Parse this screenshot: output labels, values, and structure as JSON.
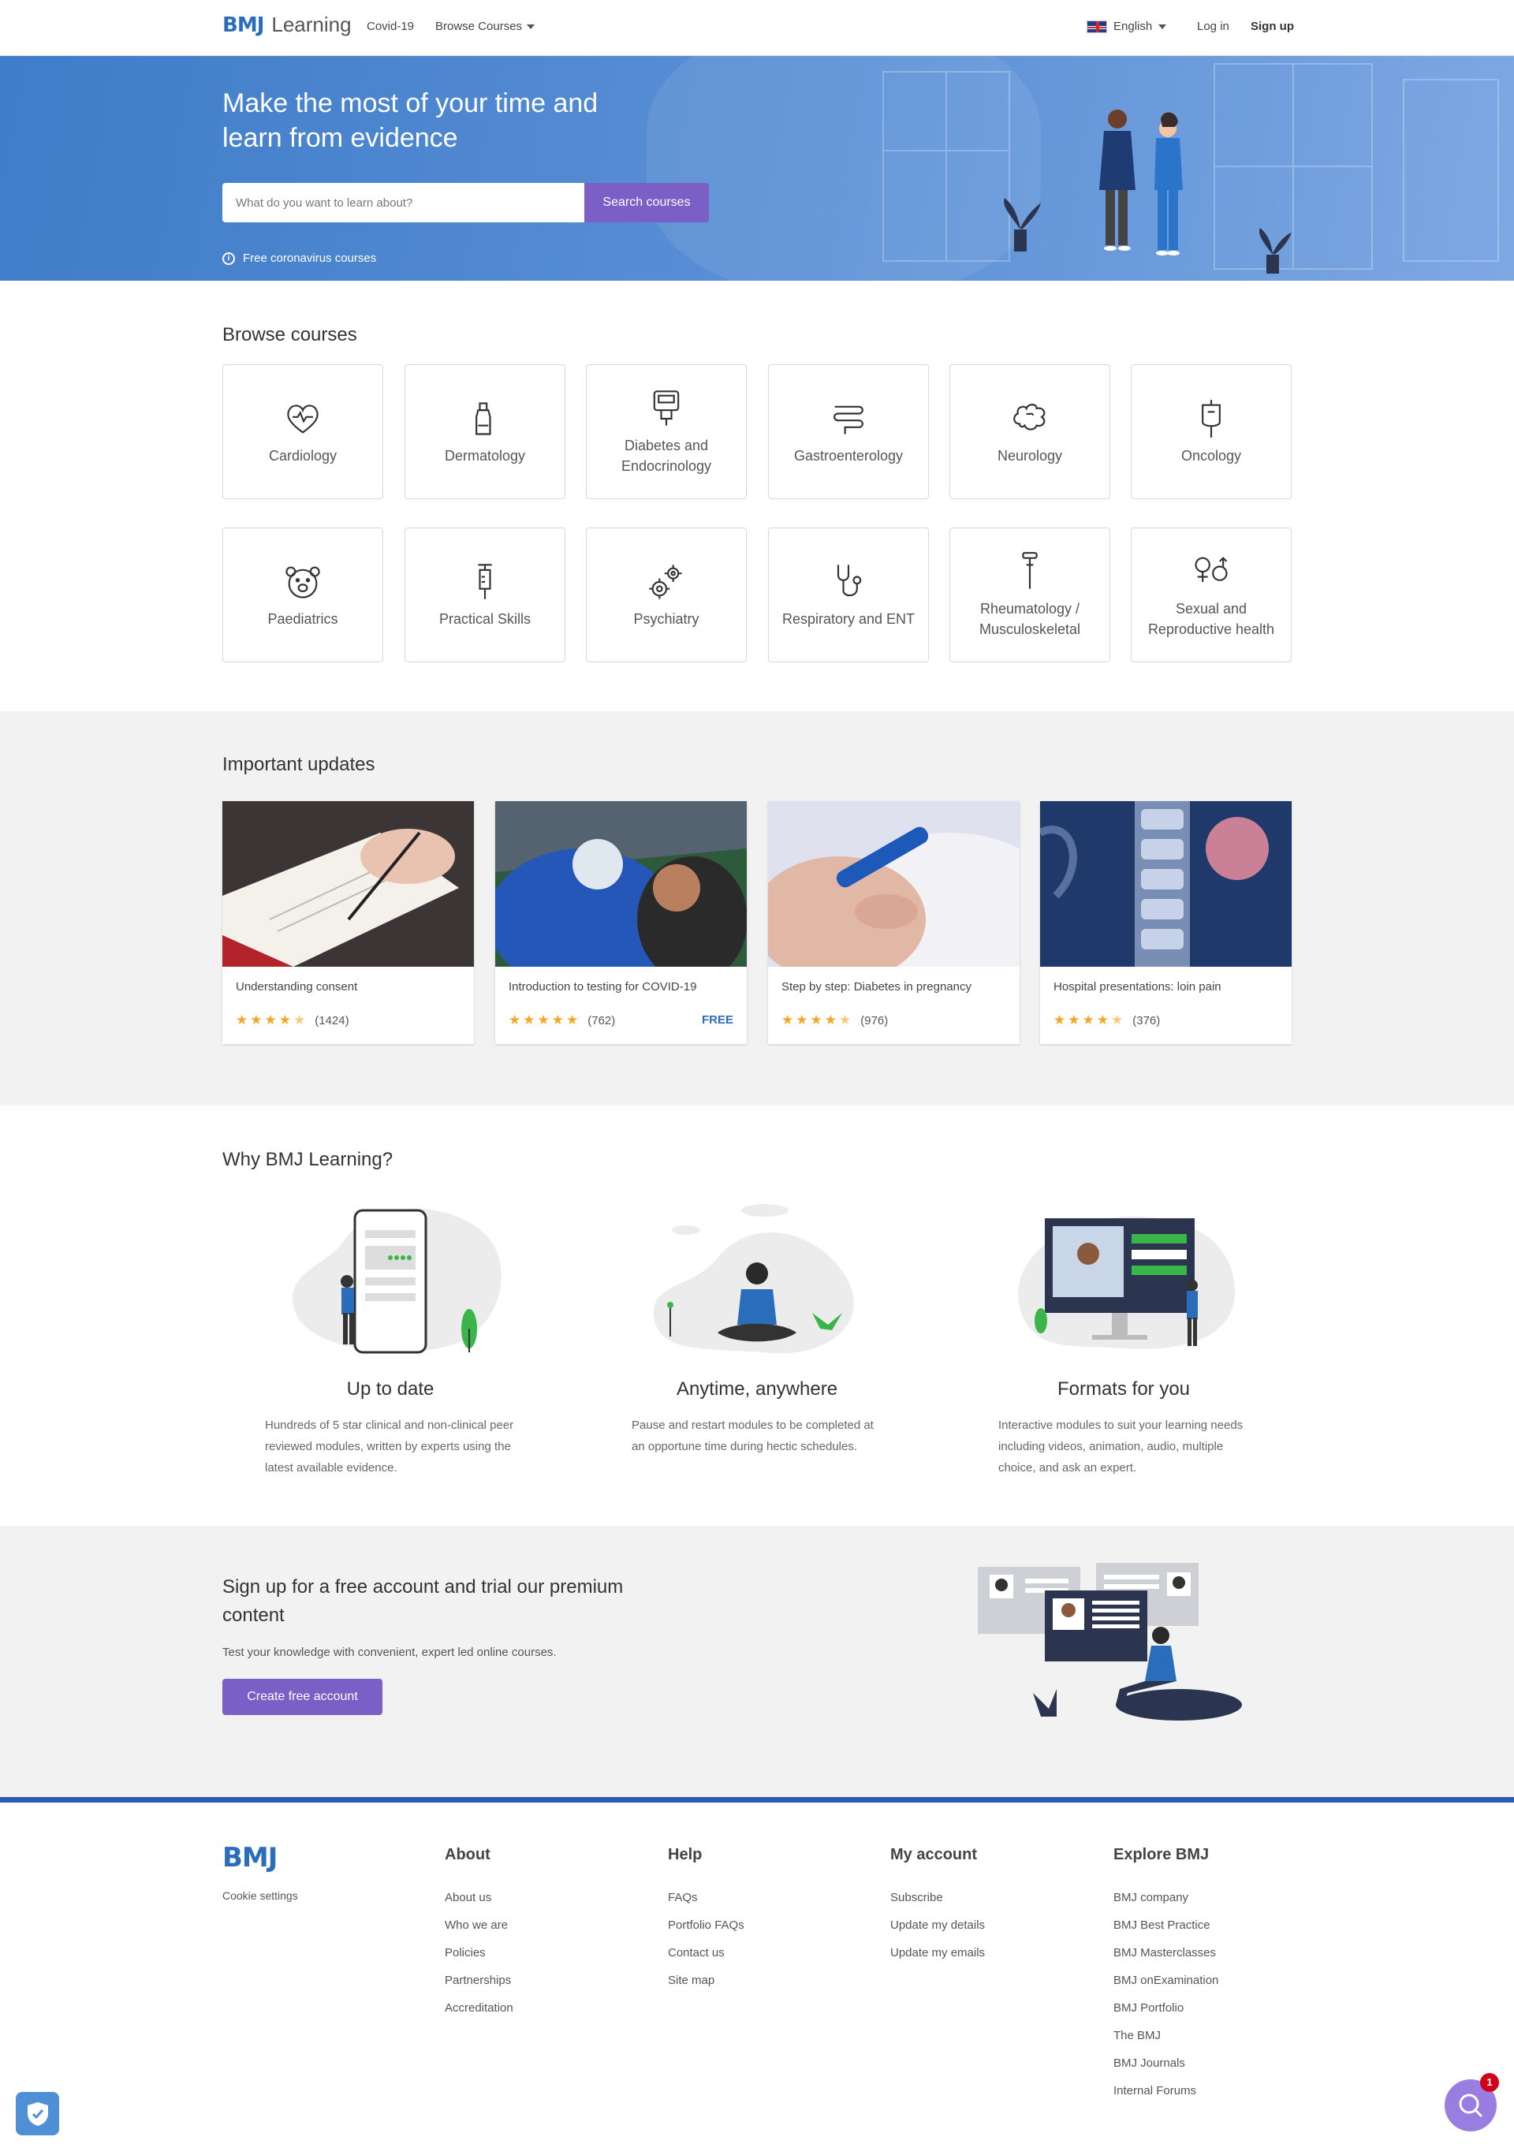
{
  "header": {
    "logo_bmj": "BMJ",
    "logo_learning": "Learning",
    "nav_covid": "Covid-19",
    "nav_browse": "Browse Courses",
    "language": "English",
    "login": "Log in",
    "signup": "Sign up"
  },
  "hero": {
    "title": "Make the most of your time and learn from evidence",
    "search_placeholder": "What do you want to learn about?",
    "search_button": "Search courses",
    "free_link": "Free coronavirus courses"
  },
  "browse": {
    "title": "Browse courses",
    "courses": [
      {
        "label": "Cardiology",
        "icon": "heart-icon"
      },
      {
        "label": "Dermatology",
        "icon": "lotion-bottle-icon"
      },
      {
        "label": "Diabetes and Endocrinology",
        "icon": "glucose-meter-icon"
      },
      {
        "label": "Gastroenterology",
        "icon": "intestine-icon"
      },
      {
        "label": "Neurology",
        "icon": "brain-icon"
      },
      {
        "label": "Oncology",
        "icon": "iv-bag-icon"
      },
      {
        "label": "Paediatrics",
        "icon": "teddy-bear-icon"
      },
      {
        "label": "Practical Skills",
        "icon": "syringe-icon"
      },
      {
        "label": "Psychiatry",
        "icon": "gears-icon"
      },
      {
        "label": "Respiratory and ENT",
        "icon": "stethoscope-icon"
      },
      {
        "label": "Rheumatology / Musculoskeletal",
        "icon": "reflex-hammer-icon"
      },
      {
        "label": "Sexual and Reproductive health",
        "icon": "gender-symbols-icon"
      }
    ]
  },
  "updates": {
    "title": "Important updates",
    "items": [
      {
        "name": "Understanding consent",
        "rating": 4.5,
        "count": "(1424)",
        "badge": ""
      },
      {
        "name": "Introduction to testing for COVID-19",
        "rating": 5,
        "count": "(762)",
        "badge": "FREE"
      },
      {
        "name": "Step by step: Diabetes in pregnancy",
        "rating": 4.5,
        "count": "(976)",
        "badge": ""
      },
      {
        "name": "Hospital presentations: loin pain",
        "rating": 4.5,
        "count": "(376)",
        "badge": ""
      }
    ]
  },
  "why": {
    "title": "Why BMJ Learning?",
    "items": [
      {
        "head": "Up to date",
        "text": "Hundreds of 5 star clinical and non-clinical peer reviewed modules, written by experts using the latest available evidence."
      },
      {
        "head": "Anytime, anywhere",
        "text": "Pause and restart modules to be completed at an opportune time during hectic schedules."
      },
      {
        "head": "Formats for you",
        "text": "Interactive modules to suit your learning needs including videos, animation, audio, multiple choice, and ask an expert."
      }
    ]
  },
  "signup": {
    "title": "Sign up for a free account and trial our premium content",
    "text": "Test your knowledge with convenient, expert led online courses.",
    "button": "Create free account"
  },
  "footer": {
    "logo": "BMJ",
    "cookie": "Cookie settings",
    "columns": [
      {
        "head": "About",
        "links": [
          "About us",
          "Who we are",
          "Policies",
          "Partnerships",
          "Accreditation"
        ]
      },
      {
        "head": "Help",
        "links": [
          "FAQs",
          "Portfolio FAQs",
          "Contact us",
          "Site map"
        ]
      },
      {
        "head": "My account",
        "links": [
          "Subscribe",
          "Update my details",
          "Update my emails"
        ]
      },
      {
        "head": "Explore BMJ",
        "links": [
          "BMJ company",
          "BMJ Best Practice",
          "BMJ Masterclasses",
          "BMJ onExamination",
          "BMJ Portfolio",
          "The BMJ",
          "BMJ Journals",
          "Internal Forums"
        ]
      }
    ]
  },
  "widgets": {
    "chat_badge": "1"
  },
  "colors": {
    "brand_blue": "#2a6ebb",
    "accent_purple": "#7b5fc7",
    "star": "#f5a623"
  }
}
